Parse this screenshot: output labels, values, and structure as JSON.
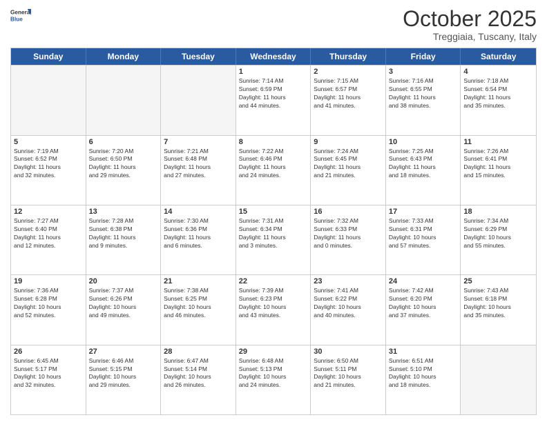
{
  "logo": {
    "line1": "General",
    "line2": "Blue"
  },
  "title": "October 2025",
  "location": "Treggiaia, Tuscany, Italy",
  "day_headers": [
    "Sunday",
    "Monday",
    "Tuesday",
    "Wednesday",
    "Thursday",
    "Friday",
    "Saturday"
  ],
  "weeks": [
    [
      {
        "num": "",
        "info": "",
        "empty": true
      },
      {
        "num": "",
        "info": "",
        "empty": true
      },
      {
        "num": "",
        "info": "",
        "empty": true
      },
      {
        "num": "1",
        "info": "Sunrise: 7:14 AM\nSunset: 6:59 PM\nDaylight: 11 hours\nand 44 minutes.",
        "empty": false
      },
      {
        "num": "2",
        "info": "Sunrise: 7:15 AM\nSunset: 6:57 PM\nDaylight: 11 hours\nand 41 minutes.",
        "empty": false
      },
      {
        "num": "3",
        "info": "Sunrise: 7:16 AM\nSunset: 6:55 PM\nDaylight: 11 hours\nand 38 minutes.",
        "empty": false
      },
      {
        "num": "4",
        "info": "Sunrise: 7:18 AM\nSunset: 6:54 PM\nDaylight: 11 hours\nand 35 minutes.",
        "empty": false
      }
    ],
    [
      {
        "num": "5",
        "info": "Sunrise: 7:19 AM\nSunset: 6:52 PM\nDaylight: 11 hours\nand 32 minutes.",
        "empty": false
      },
      {
        "num": "6",
        "info": "Sunrise: 7:20 AM\nSunset: 6:50 PM\nDaylight: 11 hours\nand 29 minutes.",
        "empty": false
      },
      {
        "num": "7",
        "info": "Sunrise: 7:21 AM\nSunset: 6:48 PM\nDaylight: 11 hours\nand 27 minutes.",
        "empty": false
      },
      {
        "num": "8",
        "info": "Sunrise: 7:22 AM\nSunset: 6:46 PM\nDaylight: 11 hours\nand 24 minutes.",
        "empty": false
      },
      {
        "num": "9",
        "info": "Sunrise: 7:24 AM\nSunset: 6:45 PM\nDaylight: 11 hours\nand 21 minutes.",
        "empty": false
      },
      {
        "num": "10",
        "info": "Sunrise: 7:25 AM\nSunset: 6:43 PM\nDaylight: 11 hours\nand 18 minutes.",
        "empty": false
      },
      {
        "num": "11",
        "info": "Sunrise: 7:26 AM\nSunset: 6:41 PM\nDaylight: 11 hours\nand 15 minutes.",
        "empty": false
      }
    ],
    [
      {
        "num": "12",
        "info": "Sunrise: 7:27 AM\nSunset: 6:40 PM\nDaylight: 11 hours\nand 12 minutes.",
        "empty": false
      },
      {
        "num": "13",
        "info": "Sunrise: 7:28 AM\nSunset: 6:38 PM\nDaylight: 11 hours\nand 9 minutes.",
        "empty": false
      },
      {
        "num": "14",
        "info": "Sunrise: 7:30 AM\nSunset: 6:36 PM\nDaylight: 11 hours\nand 6 minutes.",
        "empty": false
      },
      {
        "num": "15",
        "info": "Sunrise: 7:31 AM\nSunset: 6:34 PM\nDaylight: 11 hours\nand 3 minutes.",
        "empty": false
      },
      {
        "num": "16",
        "info": "Sunrise: 7:32 AM\nSunset: 6:33 PM\nDaylight: 11 hours\nand 0 minutes.",
        "empty": false
      },
      {
        "num": "17",
        "info": "Sunrise: 7:33 AM\nSunset: 6:31 PM\nDaylight: 10 hours\nand 57 minutes.",
        "empty": false
      },
      {
        "num": "18",
        "info": "Sunrise: 7:34 AM\nSunset: 6:29 PM\nDaylight: 10 hours\nand 55 minutes.",
        "empty": false
      }
    ],
    [
      {
        "num": "19",
        "info": "Sunrise: 7:36 AM\nSunset: 6:28 PM\nDaylight: 10 hours\nand 52 minutes.",
        "empty": false
      },
      {
        "num": "20",
        "info": "Sunrise: 7:37 AM\nSunset: 6:26 PM\nDaylight: 10 hours\nand 49 minutes.",
        "empty": false
      },
      {
        "num": "21",
        "info": "Sunrise: 7:38 AM\nSunset: 6:25 PM\nDaylight: 10 hours\nand 46 minutes.",
        "empty": false
      },
      {
        "num": "22",
        "info": "Sunrise: 7:39 AM\nSunset: 6:23 PM\nDaylight: 10 hours\nand 43 minutes.",
        "empty": false
      },
      {
        "num": "23",
        "info": "Sunrise: 7:41 AM\nSunset: 6:22 PM\nDaylight: 10 hours\nand 40 minutes.",
        "empty": false
      },
      {
        "num": "24",
        "info": "Sunrise: 7:42 AM\nSunset: 6:20 PM\nDaylight: 10 hours\nand 37 minutes.",
        "empty": false
      },
      {
        "num": "25",
        "info": "Sunrise: 7:43 AM\nSunset: 6:18 PM\nDaylight: 10 hours\nand 35 minutes.",
        "empty": false
      }
    ],
    [
      {
        "num": "26",
        "info": "Sunrise: 6:45 AM\nSunset: 5:17 PM\nDaylight: 10 hours\nand 32 minutes.",
        "empty": false
      },
      {
        "num": "27",
        "info": "Sunrise: 6:46 AM\nSunset: 5:15 PM\nDaylight: 10 hours\nand 29 minutes.",
        "empty": false
      },
      {
        "num": "28",
        "info": "Sunrise: 6:47 AM\nSunset: 5:14 PM\nDaylight: 10 hours\nand 26 minutes.",
        "empty": false
      },
      {
        "num": "29",
        "info": "Sunrise: 6:48 AM\nSunset: 5:13 PM\nDaylight: 10 hours\nand 24 minutes.",
        "empty": false
      },
      {
        "num": "30",
        "info": "Sunrise: 6:50 AM\nSunset: 5:11 PM\nDaylight: 10 hours\nand 21 minutes.",
        "empty": false
      },
      {
        "num": "31",
        "info": "Sunrise: 6:51 AM\nSunset: 5:10 PM\nDaylight: 10 hours\nand 18 minutes.",
        "empty": false
      },
      {
        "num": "",
        "info": "",
        "empty": true
      }
    ]
  ]
}
